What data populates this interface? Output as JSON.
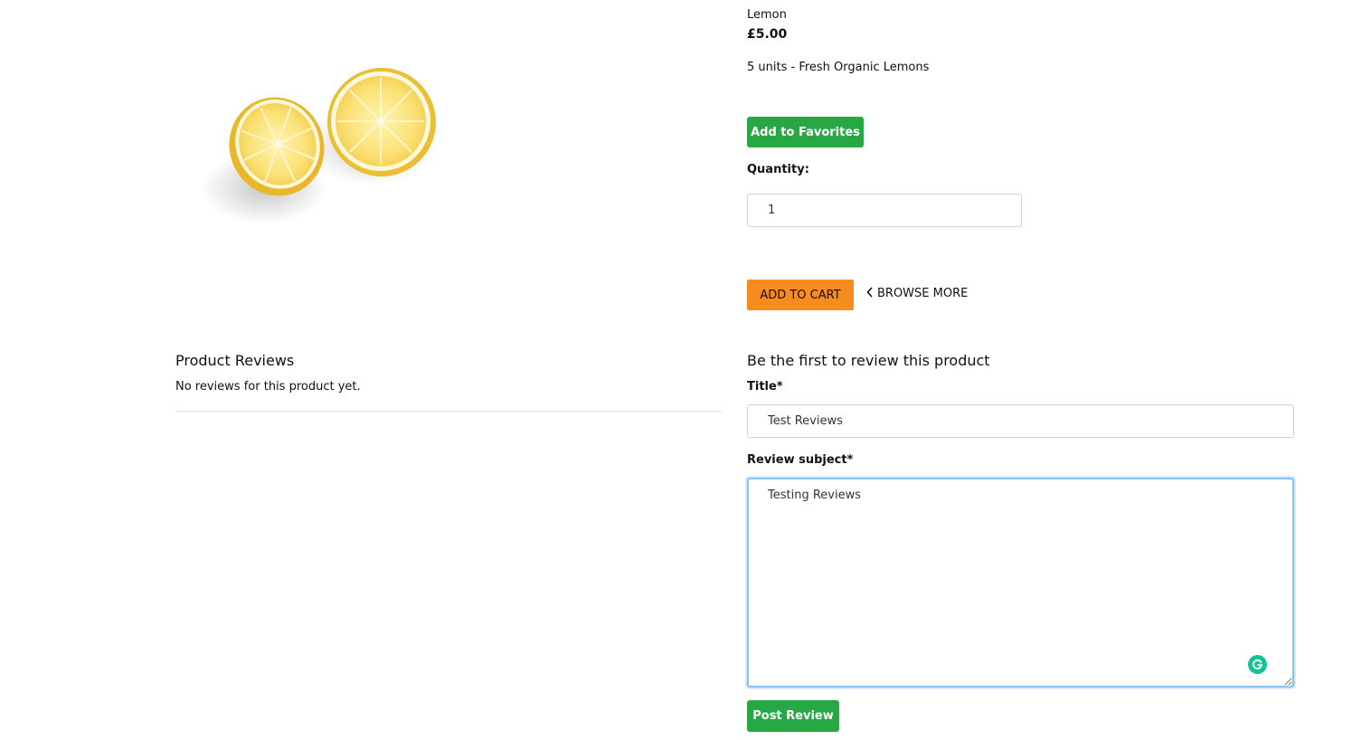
{
  "product": {
    "name": "Lemon",
    "price": "£5.00",
    "description": "5 units - Fresh Organic Lemons",
    "image_icon": "lemon-halves-image"
  },
  "actions": {
    "favorites_label": "Add to Favorites",
    "quantity_label": "Quantity:",
    "quantity_value": "1",
    "add_to_cart_label": "ADD TO CART",
    "browse_more_label": "BROWSE MORE",
    "browse_more_icon": "chevron-left-icon"
  },
  "reviews": {
    "heading": "Product Reviews",
    "empty_text": "No reviews for this product yet."
  },
  "review_form": {
    "heading": "Be the first to review this product",
    "title_label": "Title*",
    "title_value": "Test Reviews",
    "subject_label": "Review subject*",
    "subject_value": "Testing Reviews",
    "submit_label": "Post Review",
    "assistant_icon": "grammarly-icon"
  },
  "colors": {
    "green": "#28a745",
    "orange": "#f68b1f",
    "focus_border": "#8cc0f0",
    "grammarly": "#15c39a"
  }
}
